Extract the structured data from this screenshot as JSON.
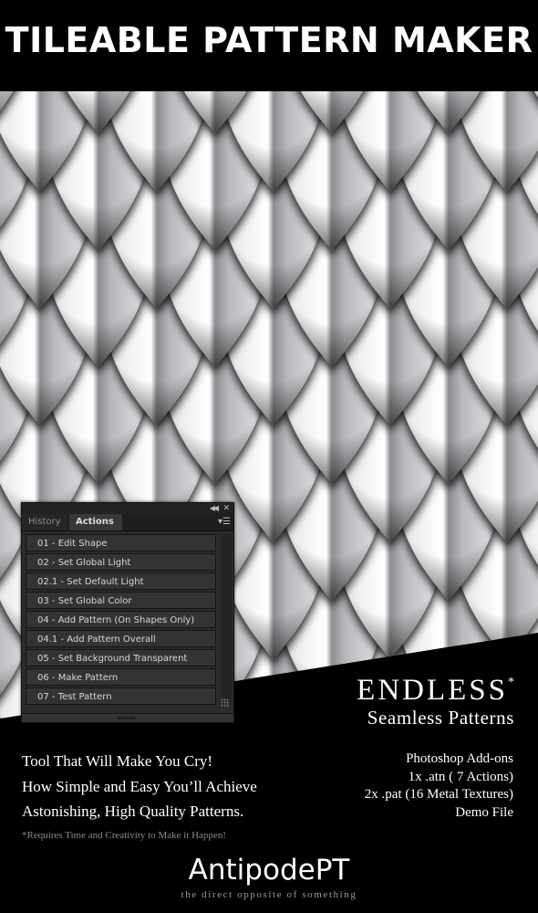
{
  "header": {
    "title": "TILEABLE PATTERN MAKER"
  },
  "pattern": {
    "description": "metal dragon scales texture",
    "colors": {
      "highlight": "#f2f2f4",
      "mid": "#9a9aa0",
      "shadow": "#050505"
    }
  },
  "panel": {
    "tabs": [
      {
        "label": "History",
        "active": false
      },
      {
        "label": "Actions",
        "active": true
      }
    ],
    "controls": {
      "collapse_icon": "double-chevron-left-icon",
      "close_icon": "close-icon",
      "menu_icon": "panel-menu-icon"
    },
    "actions": [
      "01 - Edit Shape",
      "02 - Set Global Light",
      "02.1 - Set Default Light",
      "03 - Set Global Color",
      "04 - Add Pattern (On Shapes Only)",
      "04.1 - Add Pattern Overall",
      "05 - Set Background Transparent",
      "06 - Make Pattern",
      "07 - Test Pattern"
    ]
  },
  "headline": {
    "main": "ENDLESS",
    "asterisk": "*",
    "sub": "Seamless Patterns"
  },
  "tagline": [
    "Tool That Will Make You Cry!",
    "How Simple and Easy You’ll Achieve",
    "Astonishing, High Quality Patterns."
  ],
  "disclaimer": "*Requires Time and Creativity to Make it Happen!",
  "addons": [
    "Photoshop Add-ons",
    "1x .atn ( 7 Actions)",
    "2x .pat (16 Metal Textures)",
    "Demo File"
  ],
  "brand": {
    "name": "AntipodePT",
    "slogan": "the direct opposite of something"
  }
}
